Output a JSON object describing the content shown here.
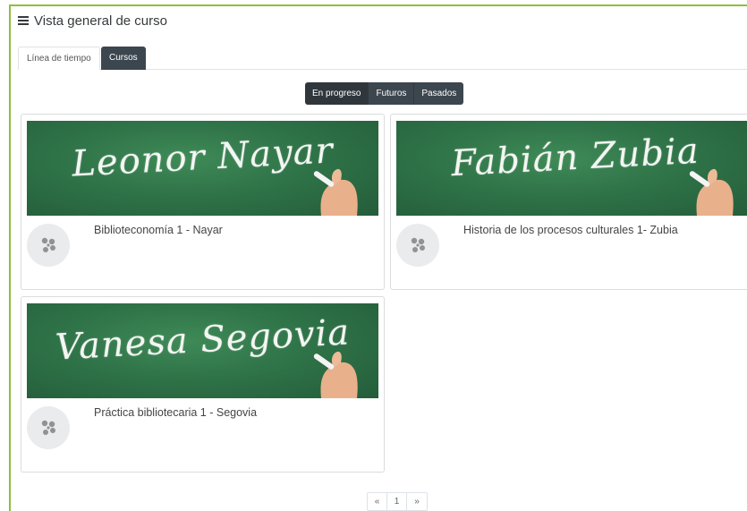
{
  "header": {
    "title": "Vista general de curso",
    "icon": "hamburger-icon"
  },
  "tabs": [
    {
      "label": "Línea de tiempo",
      "active": false
    },
    {
      "label": "Cursos",
      "active": true
    }
  ],
  "filters": [
    {
      "label": "En progreso",
      "active": true
    },
    {
      "label": "Futuros",
      "active": false
    },
    {
      "label": "Pasados",
      "active": false
    }
  ],
  "courses": [
    {
      "banner_text": "Leonor Nayar",
      "name": "Biblioteconomía 1 - Nayar",
      "icon": "course-icon"
    },
    {
      "banner_text": "Fabián Zubia",
      "name": "Historia de los procesos culturales 1- Zubia",
      "icon": "course-icon"
    },
    {
      "banner_text": "Vanesa Segovia",
      "name": "Práctica bibliotecaria 1 - Segovia",
      "icon": "course-icon"
    }
  ],
  "pagination": {
    "prev": "«",
    "current": "1",
    "next": "»"
  },
  "colors": {
    "accent_border": "#8fbe3e",
    "dark_button": "#3c464f",
    "chalkboard": "#2f7348"
  }
}
